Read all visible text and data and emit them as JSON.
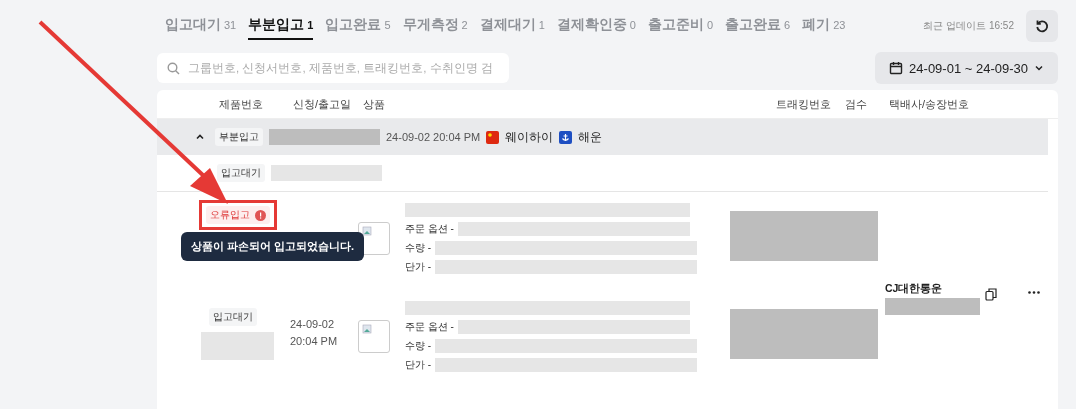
{
  "tabs": [
    {
      "label": "입고대기",
      "count": "31",
      "selected": false
    },
    {
      "label": "부분입고",
      "count": "1",
      "selected": true
    },
    {
      "label": "입고완료",
      "count": "5",
      "selected": false
    },
    {
      "label": "무게측정",
      "count": "2",
      "selected": false
    },
    {
      "label": "결제대기",
      "count": "1",
      "selected": false
    },
    {
      "label": "결제확인중",
      "count": "0",
      "selected": false
    },
    {
      "label": "출고준비",
      "count": "0",
      "selected": false
    },
    {
      "label": "출고완료",
      "count": "6",
      "selected": false
    },
    {
      "label": "폐기",
      "count": "23",
      "selected": false
    }
  ],
  "last_update": "최근 업데이트 16:52",
  "search": {
    "placeholder": "그룹번호, 신청서번호, 제품번호, 트래킹번호, 수취인명 검"
  },
  "date_range": "24-09-01 ~ 24-09-30",
  "columns": [
    "제품번호",
    "신청/출고일",
    "상품",
    "트래킹번호",
    "검수",
    "택배사/송장번호"
  ],
  "group": {
    "expanded": true,
    "status": "부분입고",
    "date": "24-09-02 20:04 PM",
    "origin": "웨이하이",
    "shipping": "해운",
    "substatus": "입고대기"
  },
  "items": [
    {
      "kind": "error",
      "status": "오류입고",
      "fields": [
        "주문 옵션 -",
        "수량 -",
        "단가 -"
      ]
    },
    {
      "kind": "normal",
      "status": "입고대기",
      "date_lines": [
        "24-09-02",
        "20:04 PM"
      ],
      "fields": [
        "주문 옵션 -",
        "수량 -",
        "단가 -"
      ]
    }
  ],
  "carrier": "CJ대한통운",
  "tooltip": "상품이 파손되어 입고되었습니다."
}
